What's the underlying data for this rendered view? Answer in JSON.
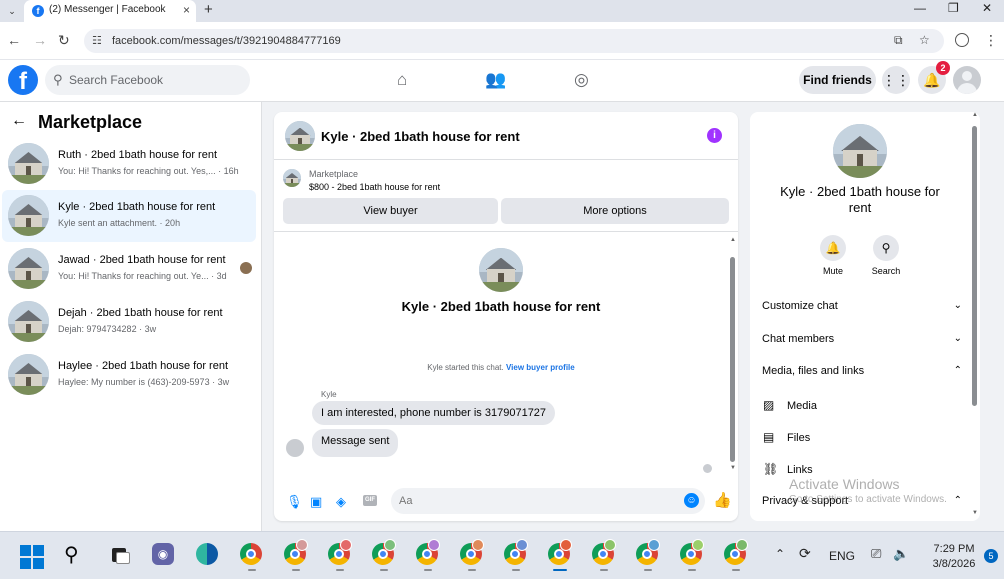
{
  "browser": {
    "tab_title": "(2) Messenger | Facebook",
    "tab_favicon": "facebook-icon",
    "url": "facebook.com/messages/t/3921904884777169"
  },
  "fb_header": {
    "search_placeholder": "Search Facebook",
    "find_friends": "Find friends",
    "notification_count": "2",
    "nav_icons": [
      "home-icon",
      "friends-icon",
      "groups-icon"
    ]
  },
  "left_panel": {
    "heading": "Marketplace",
    "conversations": [
      {
        "name": "Ruth · 2bed 1bath house for rent",
        "preview": "You: Hi! Thanks for reaching out. Yes,... · 16h",
        "active": false
      },
      {
        "name": "Kyle · 2bed 1bath house for rent",
        "preview": "Kyle sent an attachment. · 20h",
        "active": true
      },
      {
        "name": "Jawad · 2bed 1bath house for rent",
        "preview": "You: Hi! Thanks for reaching out. Ye... · 3d",
        "active": false
      },
      {
        "name": "Dejah · 2bed 1bath house for rent",
        "preview": "Dejah: 9794734282 · 3w",
        "active": false
      },
      {
        "name": "Haylee · 2bed 1bath house for rent",
        "preview": "Haylee: My number is (463)-209-5973 · 3w",
        "active": false
      }
    ]
  },
  "chat": {
    "title": "Kyle · 2bed 1bath house for rent",
    "marketplace_label": "Marketplace",
    "listing_price": "$800 - 2bed 1bath house for rent",
    "view_buyer": "View buyer",
    "more_options": "More options",
    "center_title": "Kyle · 2bed 1bath house for rent",
    "started_text": "Kyle started this chat.",
    "started_link": "View buyer profile",
    "sender_name": "Kyle",
    "messages": [
      "I am interested, phone number is 3179071727",
      "Message sent"
    ],
    "input_placeholder": "Aa"
  },
  "details": {
    "title": "Kyle · 2bed 1bath house for rent",
    "actions": [
      {
        "label": "Mute",
        "icon": "bell-icon"
      },
      {
        "label": "Search",
        "icon": "search-icon"
      }
    ],
    "sections": [
      {
        "label": "Customize chat",
        "expanded": false
      },
      {
        "label": "Chat members",
        "expanded": false
      },
      {
        "label": "Media, files and links",
        "expanded": true
      },
      {
        "label": "Privacy & support",
        "expanded": true
      }
    ],
    "media_items": [
      {
        "label": "Media",
        "icon": "photo-icon"
      },
      {
        "label": "Files",
        "icon": "file-icon"
      },
      {
        "label": "Links",
        "icon": "link-icon"
      }
    ]
  },
  "watermark": {
    "line1": "Activate Windows",
    "line2": "Go to Settings to activate Windows."
  },
  "taskbar": {
    "language": "ENG",
    "time": "7:29 PM",
    "date": "3/8/2026",
    "notification_count": "5"
  },
  "colors": {
    "facebook_blue": "#1877f2",
    "messenger_blue": "#0084ff",
    "active_conversation": "#ebf5ff",
    "link_blue": "#1b74e4",
    "info_purple": "#a033ff"
  }
}
